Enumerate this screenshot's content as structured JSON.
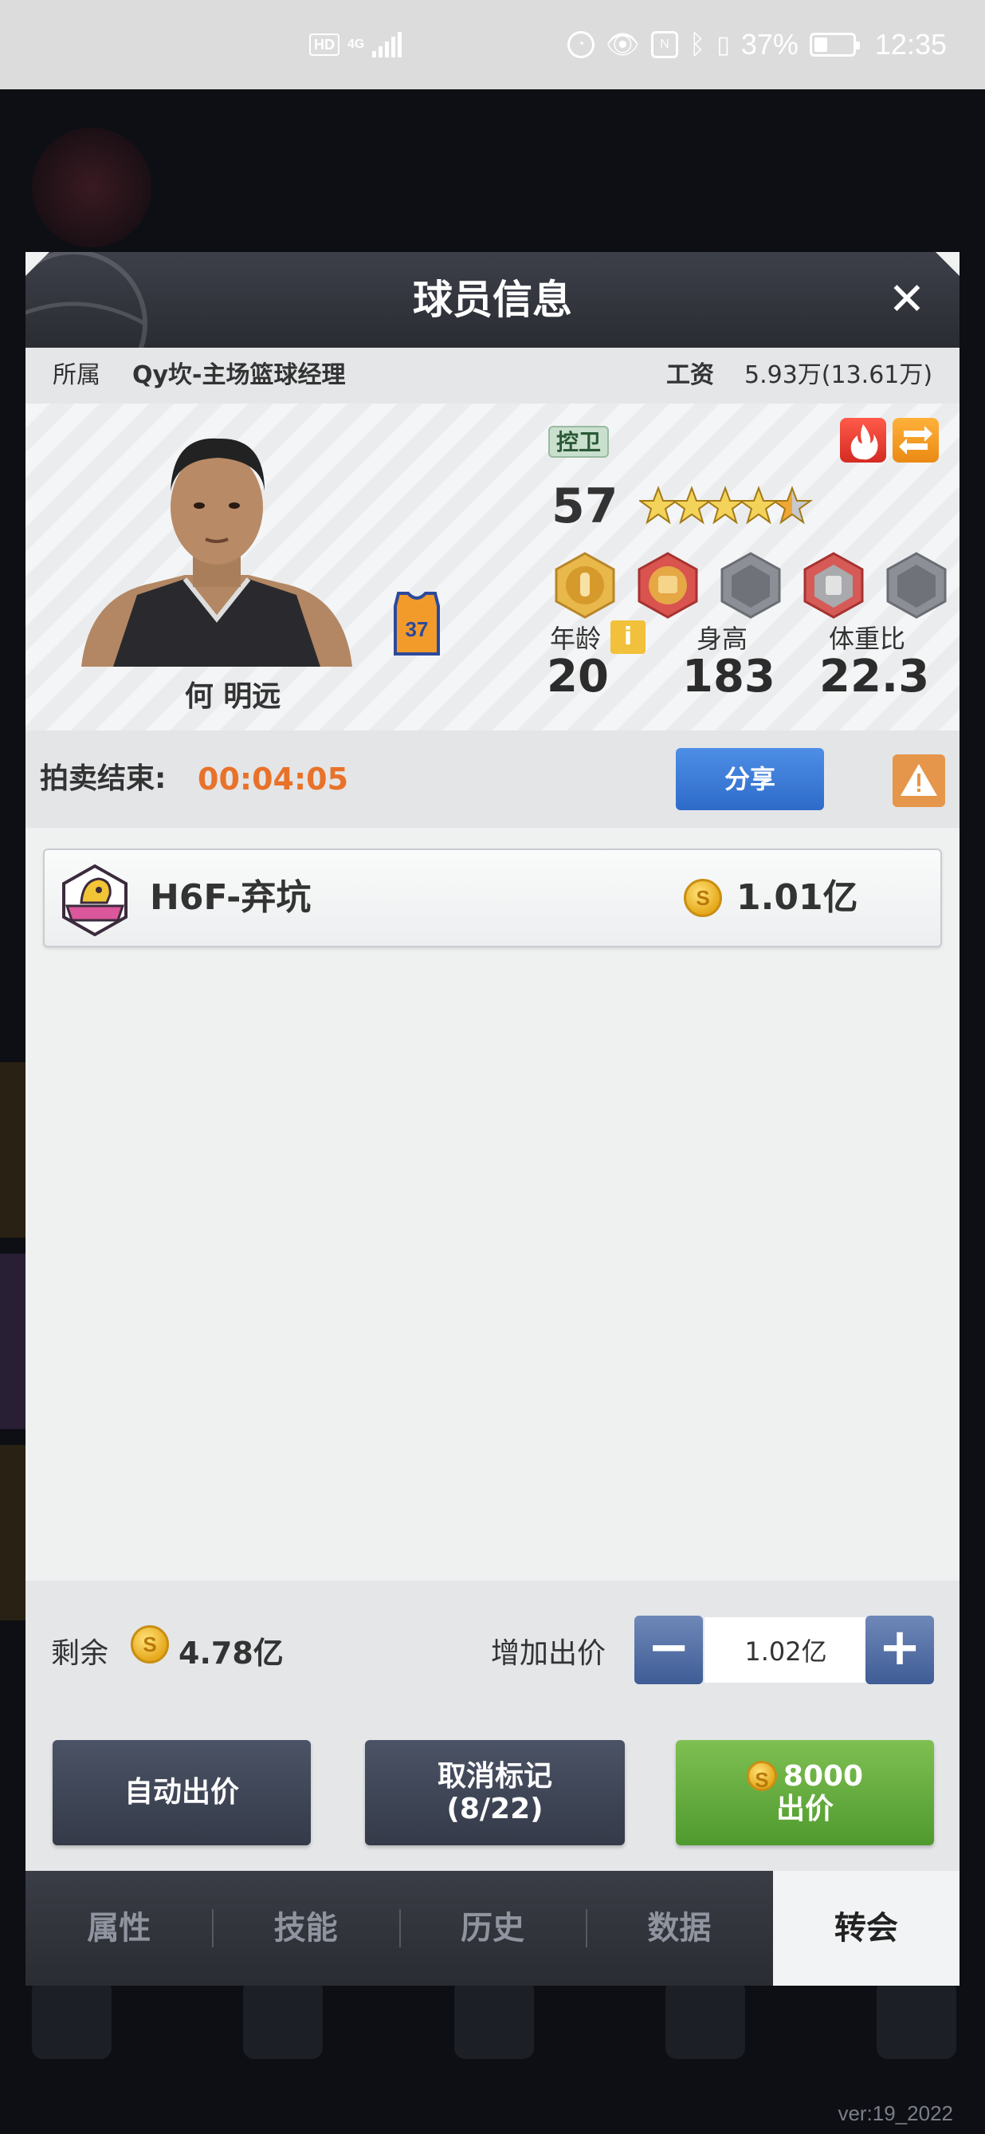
{
  "status_bar": {
    "hd": "HD",
    "network": "4G",
    "battery_pct": "37%",
    "time": "12:35"
  },
  "dialog": {
    "title": "球员信息",
    "affiliation_label": "所属",
    "affiliation_value": "Qy坎-主场篮球经理",
    "salary_label": "工资",
    "salary_value": "5.93万(13.61万)"
  },
  "player": {
    "name": "何 明远",
    "jersey_number": "37",
    "position": "控卫",
    "rating": "57",
    "stars": 4.5,
    "skill_icons": [
      "skill-gold-icon",
      "skill-red-icon",
      "skill-locked-icon",
      "skill-red-alt-icon",
      "skill-locked-icon"
    ],
    "stats": {
      "age_label": "年龄",
      "age_info": "i",
      "age": "20",
      "height_label": "身高",
      "height": "183",
      "bmi_label": "体重比",
      "bmi": "22.3"
    }
  },
  "auction": {
    "end_label": "拍卖结束:",
    "time_left": "00:04:05",
    "share_label": "分享"
  },
  "bids": [
    {
      "team": "H6F-弃坑",
      "amount": "1.01亿"
    }
  ],
  "bottom": {
    "remain_label": "剩余",
    "remain_value": "4.78亿",
    "inc_label": "增加出价",
    "inc_value": "1.02亿",
    "auto_bid_label": "自动出价",
    "cancel_mark_line1": "取消标记",
    "cancel_mark_line2": "(8/22)",
    "bid_cost": "8000",
    "bid_label": "出价"
  },
  "tabs": [
    {
      "label": "属性"
    },
    {
      "label": "技能"
    },
    {
      "label": "历史"
    },
    {
      "label": "数据"
    },
    {
      "label": "转会"
    }
  ],
  "active_tab": 4,
  "version": "ver:19_2022"
}
